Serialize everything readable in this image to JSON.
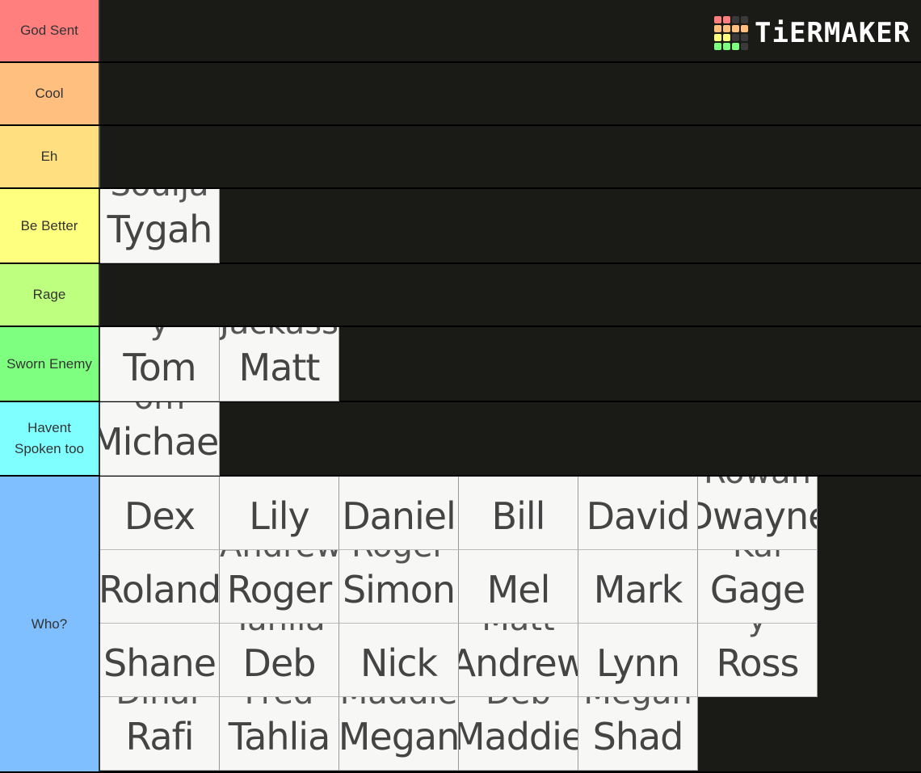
{
  "brand": {
    "logo_text": "TiERMAKER",
    "grid_colors": [
      "#ff7f7f",
      "#ff7f7f",
      "#3a3a3a",
      "#3a3a3a",
      "#ffbf7f",
      "#ffbf7f",
      "#ffbf7f",
      "#ffbf7f",
      "#ffff7f",
      "#ffff7f",
      "#3a3a3a",
      "#3a3a3a",
      "#7fff7f",
      "#7fff7f",
      "#7fff7f",
      "#3a3a3a"
    ]
  },
  "tiers": [
    {
      "label": "God Sent",
      "color": "#ff7f7f",
      "items": []
    },
    {
      "label": "Cool",
      "color": "#ffbf7f",
      "items": []
    },
    {
      "label": "Eh",
      "color": "#ffdf7f",
      "items": []
    },
    {
      "label": "Be Better",
      "color": "#ffff7f",
      "items": [
        {
          "name": "Tygah",
          "ghost": "Soulja"
        }
      ]
    },
    {
      "label": "Rage",
      "color": "#bfff7f",
      "items": []
    },
    {
      "label": "Sworn Enemy",
      "color": "#7fff7f",
      "items": [
        {
          "name": "Tom",
          "ghost": "y"
        },
        {
          "name": "Matt",
          "ghost": "Jackass"
        }
      ]
    },
    {
      "label": "Havent Spoken too",
      "color": "#7fffff",
      "items": [
        {
          "name": "Michael",
          "ghost": "om"
        }
      ]
    },
    {
      "label": "Who?",
      "color": "#7fbfff",
      "items": [
        {
          "name": "Dex",
          "ghost": ""
        },
        {
          "name": "Lily",
          "ghost": ""
        },
        {
          "name": "Daniel",
          "ghost": ""
        },
        {
          "name": "Bill",
          "ghost": ""
        },
        {
          "name": "David",
          "ghost": ""
        },
        {
          "name": "Dwayne",
          "ghost": "Rowan"
        },
        {
          "name": "Roland",
          "ghost": ""
        },
        {
          "name": "Roger",
          "ghost": "Andrew"
        },
        {
          "name": "Simon",
          "ghost": "Roger"
        },
        {
          "name": "Mel",
          "ghost": ""
        },
        {
          "name": "Mark",
          "ghost": ""
        },
        {
          "name": "Gage",
          "ghost": "Kai"
        },
        {
          "name": "Shane",
          "ghost": ""
        },
        {
          "name": "Deb",
          "ghost": "Tahlia"
        },
        {
          "name": "Nick",
          "ghost": ""
        },
        {
          "name": "Andrew",
          "ghost": "Matt"
        },
        {
          "name": "Lynn",
          "ghost": ""
        },
        {
          "name": "Ross",
          "ghost": "y"
        },
        {
          "name": "Rafi",
          "ghost": "Dinar"
        },
        {
          "name": "Tahlia",
          "ghost": "Fred"
        },
        {
          "name": "Megan",
          "ghost": "Maddie"
        },
        {
          "name": "Maddie",
          "ghost": "Deb"
        },
        {
          "name": "Shad",
          "ghost": "Megan"
        }
      ]
    }
  ]
}
